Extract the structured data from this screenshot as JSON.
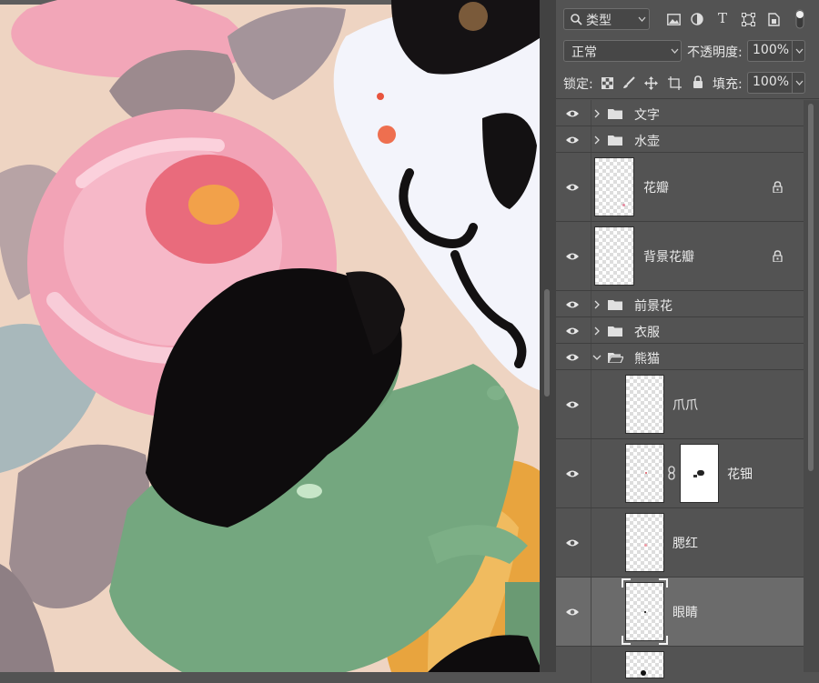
{
  "toolbar": {
    "filter_label": "类型",
    "filter_icons": [
      "image-filter-icon",
      "adjustment-filter-icon",
      "type-filter-icon",
      "shape-filter-icon",
      "smart-object-filter-icon"
    ],
    "blend_mode": "正常",
    "opacity_label": "不透明度:",
    "opacity_value": "100%",
    "lock_label": "锁定:",
    "lock_icons": [
      "lock-transparency-icon",
      "lock-pixels-icon",
      "lock-position-icon",
      "lock-artboard-icon",
      "lock-all-icon"
    ],
    "fill_label": "填充:",
    "fill_value": "100%"
  },
  "layers": [
    {
      "name": "文字",
      "kind": "group",
      "expanded": false,
      "visible": true
    },
    {
      "name": "水壶",
      "kind": "group",
      "expanded": false,
      "visible": true
    },
    {
      "name": "花瓣",
      "kind": "layer",
      "locked": true,
      "visible": true
    },
    {
      "name": "背景花瓣",
      "kind": "layer",
      "locked": true,
      "visible": true
    },
    {
      "name": "前景花",
      "kind": "group",
      "expanded": false,
      "visible": true
    },
    {
      "name": "衣服",
      "kind": "group",
      "expanded": false,
      "visible": true
    },
    {
      "name": "熊猫",
      "kind": "group",
      "expanded": true,
      "visible": true
    },
    {
      "name": "爪爪",
      "kind": "layer",
      "indent": 1,
      "visible": true
    },
    {
      "name": "花钿",
      "kind": "layer",
      "indent": 1,
      "mask": true,
      "visible": true
    },
    {
      "name": "腮红",
      "kind": "layer",
      "indent": 1,
      "visible": true
    },
    {
      "name": "眼睛",
      "kind": "layer",
      "indent": 1,
      "selected": true,
      "visible": true
    }
  ],
  "colors": {
    "panel_bg": "#535353",
    "selected_row": "#6b6b6b",
    "canvas_bg": "#eed4c2",
    "peony_pink": "#f0a3b8",
    "leaf_mauve": "#9c8a8e",
    "kettle_green": "#74a77f",
    "orange_fabric": "#e8a43e"
  }
}
